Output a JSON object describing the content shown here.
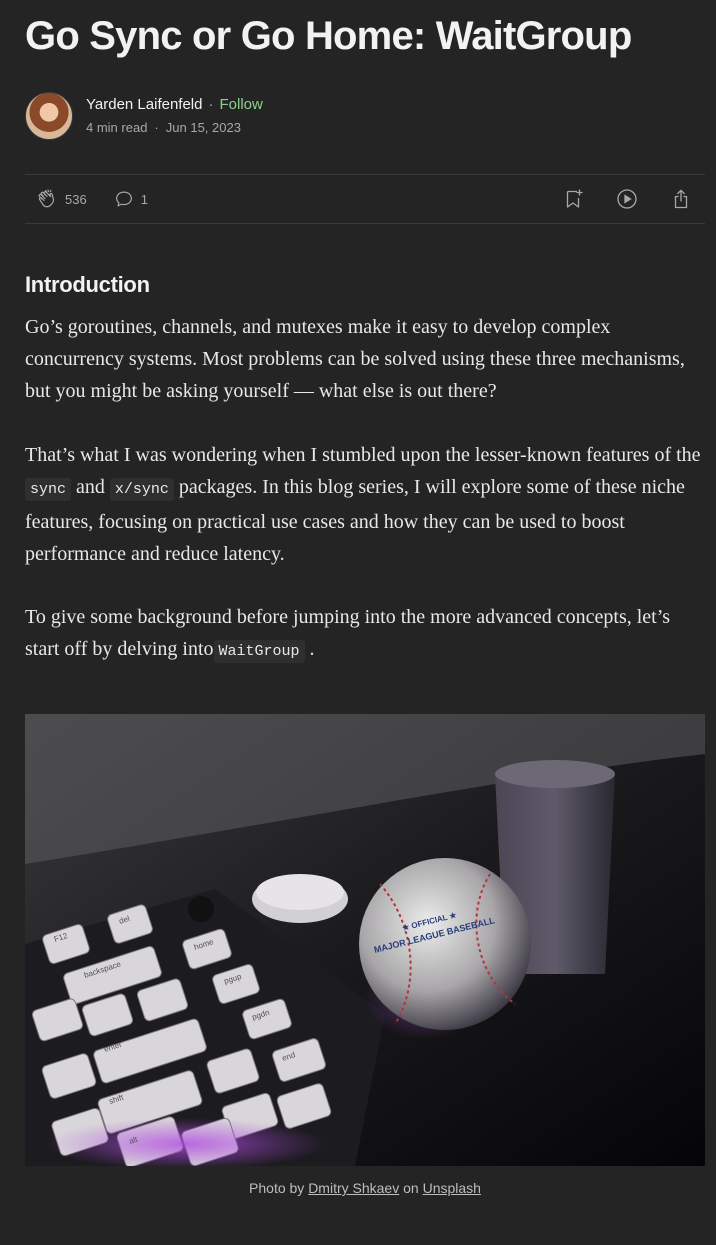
{
  "article": {
    "title": "Go Sync or Go Home: WaitGroup",
    "author": "Yarden Laifenfeld",
    "follow_label": "Follow",
    "read_time": "4 min read",
    "date": "Jun 15, 2023",
    "claps": "536",
    "responses": "1"
  },
  "body": {
    "heading": "Introduction",
    "p1": "Go’s goroutines, channels, and mutexes make it easy to develop complex concurrency systems. Most problems can be solved using these three mechanisms, but you might be asking yourself — what else is out there?",
    "p2_a": "That’s what I was wondering when I stumbled upon the lesser-known features of the ",
    "p2_code1": "sync",
    "p2_b": " and ",
    "p2_code2": "x/sync",
    "p2_c": " packages. In this blog series, I will explore some of these niche features, focusing on practical use cases and how they can be used to boost performance and reduce latency.",
    "p3_a": "To give some background before jumping into the more advanced concepts, let’s start off by delving into",
    "p3_code": "WaitGroup",
    "p3_b": " ."
  },
  "photo": {
    "caption_prefix": "Photo by ",
    "photographer": "Dmitry Shkaev",
    "caption_mid": " on ",
    "source": "Unsplash",
    "ball_text_1": "★ OFFICIAL ★",
    "ball_text_2": "MAJOR LEAGUE BASEBALL",
    "keys": [
      "backspace",
      "enter",
      "shift",
      "alt",
      "end",
      "pgup",
      "pgdn",
      "home",
      "F12",
      "del"
    ]
  },
  "colors": {
    "background": "#242424",
    "follow": "#8bd08a",
    "muted": "#a8a8a8",
    "divider": "#3a3a3a"
  }
}
